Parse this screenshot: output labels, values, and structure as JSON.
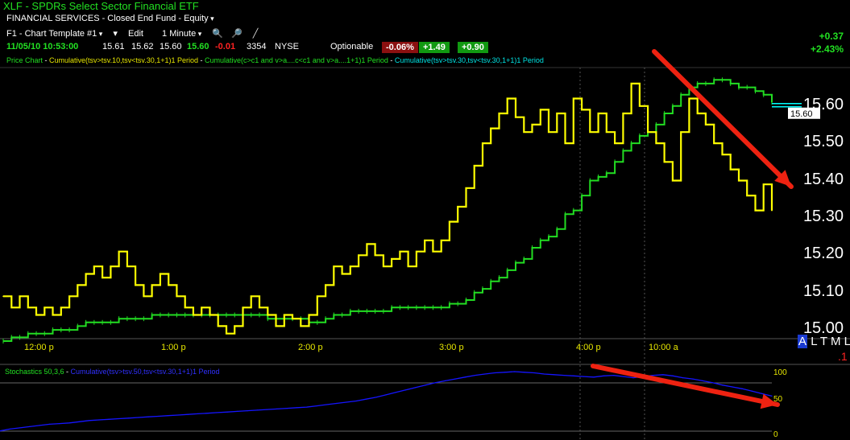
{
  "header": {
    "symbol": "XLF",
    "name": "SPDRs Select Sector Financial ETF",
    "sector": "FINANCIAL SERVICES - Closed End Fund - Equity",
    "template": "F1 - Chart Template #1",
    "edit": "Edit",
    "interval": "1 Minute",
    "datetime": "11/05/10 10:53:00",
    "open": "15.61",
    "high": "15.62",
    "low": "15.60",
    "last": "15.60",
    "change": "-0.01",
    "volume": "3354",
    "exchange": "NYSE",
    "optionable": "Optionable",
    "pct_badge": "-0.06%",
    "badge2": "+1.49",
    "badge3": "+0.90",
    "day_change": "+0.37",
    "day_pct": "+2.43%"
  },
  "indicator_legend": {
    "price": "Price Chart",
    "ind1": "Cumulative(tsv>tsv.10,tsv<tsv.30,1+1)1 Period",
    "ind2": "Cumulative(c>c1 and v>a....c<c1 and v>a....1+1)1 Period",
    "ind3": "Cumulative(tsv>tsv.30,tsv<tsv.30,1+1)1 Period"
  },
  "stoch_legend": {
    "name": "Stochastics 50,3,6",
    "ind": "Cumulative(tsv>tsv.50,tsv<tsv.30,1+1)1 Period"
  },
  "toolbar": {
    "al": "A",
    "l": "L",
    "t": "T",
    "m": "M",
    "l2": "L",
    "one": ".1"
  },
  "colors": {
    "yellow": "#ffff00",
    "green": "#22dd22",
    "blue": "#1515ff",
    "red": "#ee2211",
    "cyan": "#00ffff"
  },
  "chart_data": [
    {
      "type": "line",
      "title": "",
      "x_ticks": [
        "12:00 p",
        "1:00 p",
        "2:00 p",
        "3:00 p",
        "4:00 p",
        "10:00 a"
      ],
      "y_ticks": [
        "15.60",
        "15.50",
        "15.40",
        "15.30",
        "15.20",
        "15.10",
        "15.00"
      ],
      "ylim": [
        14.97,
        15.69
      ],
      "last_price_label": "15.60",
      "series": [
        {
          "name": "",
          "color": "yellow",
          "values": [
            15.09,
            15.06,
            15.09,
            15.06,
            15.04,
            15.06,
            15.04,
            15.06,
            15.09,
            15.12,
            15.15,
            15.17,
            15.14,
            15.17,
            15.21,
            15.17,
            15.12,
            15.09,
            15.12,
            15.15,
            15.12,
            15.09,
            15.06,
            15.04,
            15.06,
            15.04,
            15.01,
            14.99,
            15.01,
            15.06,
            15.09,
            15.06,
            15.04,
            15.01,
            15.04,
            15.03,
            15.01,
            15.04,
            15.09,
            15.12,
            15.17,
            15.15,
            15.17,
            15.2,
            15.23,
            15.2,
            15.17,
            15.19,
            15.21,
            15.17,
            15.21,
            15.24,
            15.21,
            15.24,
            15.29,
            15.33,
            15.38,
            15.44,
            15.5,
            15.54,
            15.58,
            15.62,
            15.57,
            15.53,
            15.55,
            15.59,
            15.53,
            15.58,
            15.5,
            15.62,
            15.59,
            15.53,
            15.58,
            15.53,
            15.5,
            15.58,
            15.66,
            15.6,
            15.53,
            15.5,
            15.45,
            15.4,
            15.53,
            15.62,
            15.58,
            15.55,
            15.5,
            15.47,
            15.43,
            15.4,
            15.36,
            15.32,
            15.39,
            15.32
          ]
        },
        {
          "name": "",
          "color": "green",
          "values": [
            14.97,
            14.98,
            14.98,
            14.99,
            14.99,
            14.99,
            15.0,
            15.0,
            15.0,
            15.01,
            15.02,
            15.02,
            15.02,
            15.02,
            15.03,
            15.03,
            15.03,
            15.03,
            15.04,
            15.04,
            15.04,
            15.04,
            15.04,
            15.04,
            15.04,
            15.04,
            15.04,
            15.04,
            15.04,
            15.04,
            15.04,
            15.04,
            15.03,
            15.03,
            15.03,
            15.03,
            15.03,
            15.02,
            15.02,
            15.03,
            15.04,
            15.04,
            15.05,
            15.05,
            15.05,
            15.05,
            15.05,
            15.06,
            15.06,
            15.06,
            15.06,
            15.06,
            15.06,
            15.06,
            15.07,
            15.07,
            15.08,
            15.1,
            15.11,
            15.13,
            15.14,
            15.16,
            15.18,
            15.19,
            15.22,
            15.24,
            15.25,
            15.27,
            15.31,
            15.32,
            15.36,
            15.4,
            15.41,
            15.42,
            15.45,
            15.48,
            15.5,
            15.52,
            15.53,
            15.55,
            15.58,
            15.6,
            15.63,
            15.65,
            15.66,
            15.66,
            15.67,
            15.67,
            15.66,
            15.65,
            15.65,
            15.64,
            15.63,
            15.61
          ]
        }
      ]
    },
    {
      "type": "line",
      "title": "",
      "y_ticks": [
        "100",
        "50",
        "0"
      ],
      "ylim": [
        0,
        100
      ],
      "series": [
        {
          "name": "",
          "color": "blue",
          "values": [
            3,
            6,
            8,
            10,
            12,
            14,
            15,
            16,
            18,
            20,
            21,
            22,
            23,
            24,
            25,
            26,
            27,
            28,
            29,
            30,
            31,
            32,
            33,
            34,
            35,
            36,
            37,
            38,
            39,
            40,
            41,
            42,
            44,
            46,
            48,
            50,
            52,
            55,
            58,
            62,
            66,
            70,
            74,
            78,
            82,
            85,
            88,
            91,
            94,
            96,
            98,
            99,
            100,
            99,
            98,
            96,
            95,
            94,
            93,
            92,
            91,
            93,
            94,
            92,
            90,
            92,
            94,
            95,
            93,
            90,
            88,
            85,
            82,
            78,
            75,
            72,
            68,
            64,
            60
          ]
        }
      ]
    }
  ]
}
